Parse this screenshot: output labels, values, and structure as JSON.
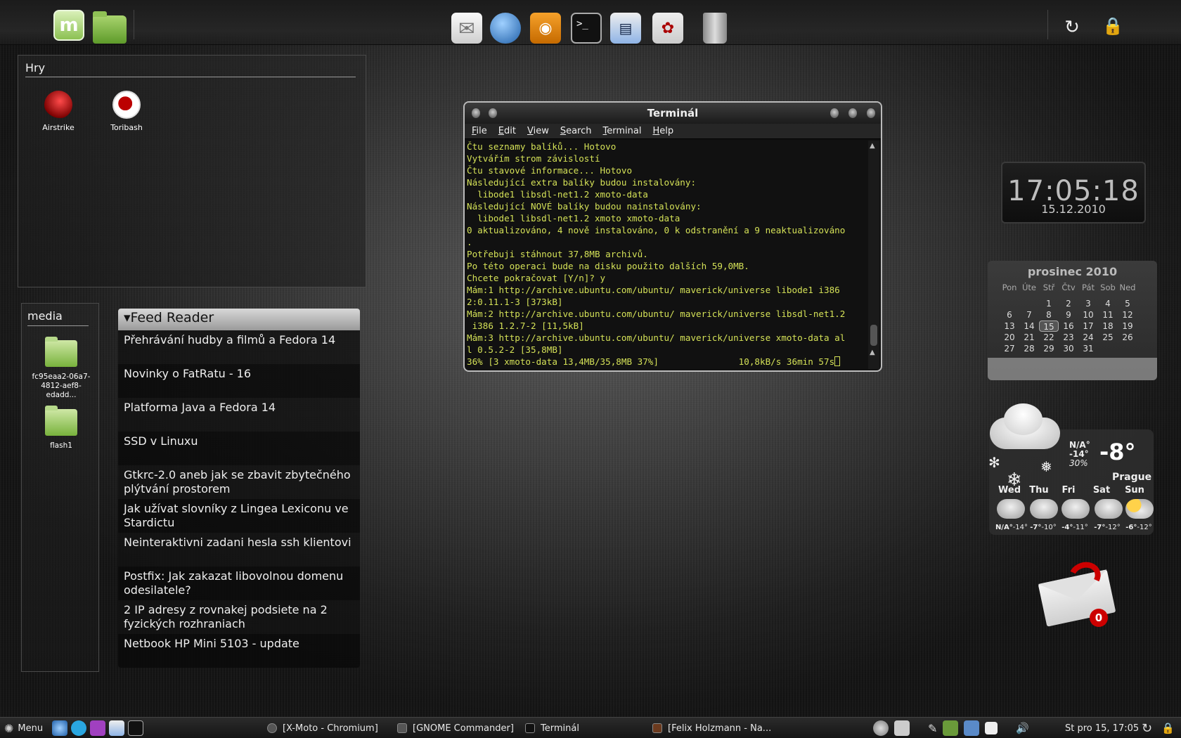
{
  "dock": {
    "icons": [
      "mint-logo-icon",
      "folder-icon",
      "mail-icon",
      "pidgin-icon",
      "eye-of-gnome-icon",
      "terminal-icon",
      "gnome-commander-icon",
      "shotwell-icon",
      "trash-icon",
      "refresh-icon",
      "lock-icon"
    ]
  },
  "hry": {
    "title": "Hry",
    "games": [
      {
        "label": "Airstrike",
        "icon": "airstrike-icon"
      },
      {
        "label": "Toribash",
        "icon": "toribash-icon"
      }
    ]
  },
  "media": {
    "title": "media",
    "items": [
      {
        "label": "fc95eaa2-06a7-4812-aef8-edadd...",
        "icon": "folder-icon"
      },
      {
        "label": "flash1",
        "icon": "folder-icon"
      }
    ]
  },
  "feed": {
    "title": "▾Feed Reader",
    "items": [
      "Přehrávání hudby a filmů a Fedora 14",
      "Novinky o FatRatu - 16",
      "Platforma Java a Fedora 14",
      "SSD v Linuxu",
      "Gtkrc-2.0 aneb jak se zbavit zbytečného plýtvání prostorem",
      "Jak užívat slovníky z Lingea Lexiconu ve Stardictu",
      "Neinteraktivni zadani hesla ssh klientovi",
      "Postfix: Jak zakazat libovolnou domenu odesilatele?",
      "2 IP adresy z rovnakej podsiete na 2 fyzických rozhraniach",
      "Netbook HP Mini 5103 - update"
    ]
  },
  "terminal": {
    "title": "Terminál",
    "menu": [
      "File",
      "Edit",
      "View",
      "Search",
      "Terminal",
      "Help"
    ],
    "lines": [
      "Čtu seznamy balíků... Hotovo",
      "Vytvářím strom závislostí",
      "Čtu stavové informace... Hotovo",
      "Následující extra balíky budou instalovány:",
      "  libode1 libsdl-net1.2 xmoto-data",
      "Následující NOVÉ balíky budou nainstalovány:",
      "  libode1 libsdl-net1.2 xmoto xmoto-data",
      "0 aktualizováno, 4 nově instalováno, 0 k odstranění a 9 neaktualizováno",
      ".",
      "Potřebuji stáhnout 37,8MB archivů.",
      "Po této operaci bude na disku použito dalších 59,0MB.",
      "Chcete pokračovat [Y/n]? y",
      "Mám:1 http://archive.ubuntu.com/ubuntu/ maverick/universe libode1 i386",
      "2:0.11.1-3 [373kB]",
      "Mám:2 http://archive.ubuntu.com/ubuntu/ maverick/universe libsdl-net1.2",
      " i386 1.2.7-2 [11,5kB]",
      "Mám:3 http://archive.ubuntu.com/ubuntu/ maverick/universe xmoto-data al",
      "l 0.5.2-2 [35,8MB]",
      "36% [3 xmoto-data 13,4MB/35,8MB 37%]               10,8kB/s 36min 57s"
    ]
  },
  "clock": {
    "time": "17:05:18",
    "date": "15.12.2010"
  },
  "calendar": {
    "month": "prosinec 2010",
    "dow": [
      "Pon",
      "Úte",
      "Stř",
      "Čtv",
      "Pát",
      "Sob",
      "Ned"
    ],
    "days": [
      "",
      "",
      "1",
      "2",
      "3",
      "4",
      "5",
      "6",
      "7",
      "8",
      "9",
      "10",
      "11",
      "12",
      "13",
      "14",
      "15",
      "16",
      "17",
      "18",
      "19",
      "20",
      "21",
      "22",
      "23",
      "24",
      "25",
      "26",
      "27",
      "28",
      "29",
      "30",
      "31",
      "",
      ""
    ],
    "today": "15"
  },
  "weather": {
    "na": "N/A°",
    "low": "-14°",
    "humidity": "30%",
    "temp": "-8°",
    "city": "Prague",
    "forecast": [
      {
        "day": "Wed",
        "hi": "N/A°",
        "lo": "-14°",
        "icon": "snow-cloud-icon"
      },
      {
        "day": "Thu",
        "hi": "-7°",
        "lo": "-10°",
        "icon": "snow-cloud-icon"
      },
      {
        "day": "Fri",
        "hi": "-4°",
        "lo": "-11°",
        "icon": "snow-cloud-icon"
      },
      {
        "day": "Sat",
        "hi": "-7°",
        "lo": "-12°",
        "icon": "cloud-icon"
      },
      {
        "day": "Sun",
        "hi": "-6°",
        "lo": "-12°",
        "icon": "partly-sunny-icon"
      }
    ]
  },
  "mail": {
    "count": "0"
  },
  "taskbar": {
    "menu": "Menu",
    "tasks": [
      "[X-Moto - Chromium]",
      "[GNOME Commander]",
      "Terminál",
      "[Felix Holzmann - Na..."
    ],
    "clock": "St pro 15, 17:05"
  }
}
